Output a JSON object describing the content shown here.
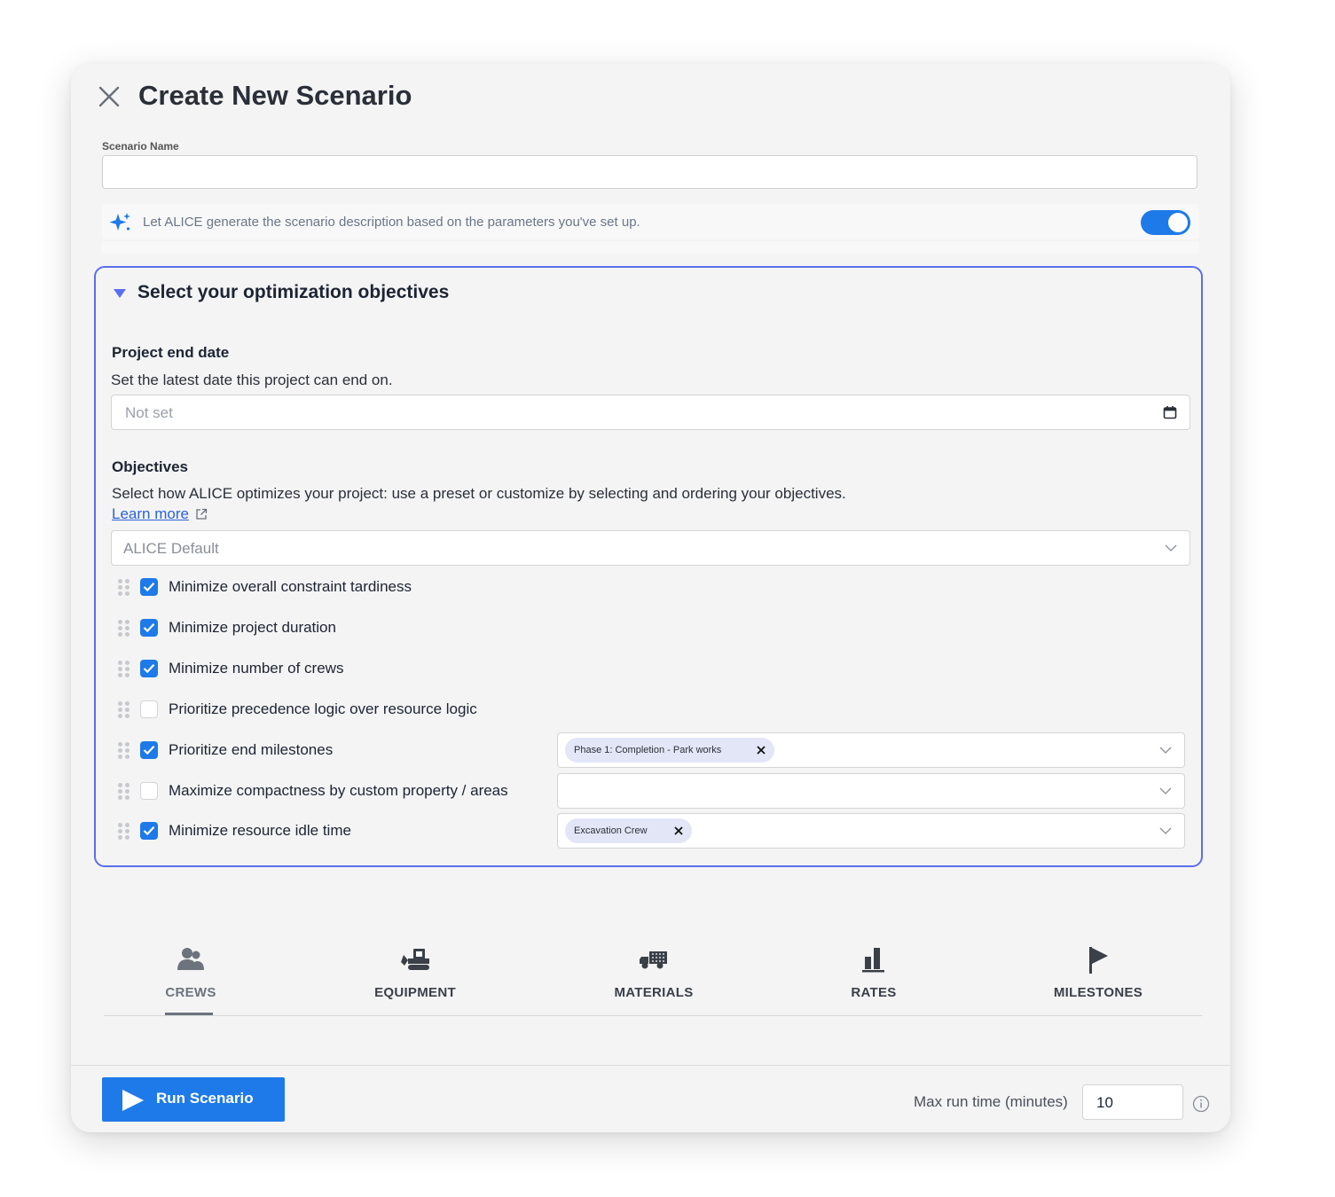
{
  "dialog": {
    "title": "Create New Scenario"
  },
  "scenario_name": {
    "label": "Scenario Name",
    "value": ""
  },
  "alice_generate": {
    "text": "Let ALICE generate the scenario description based on the parameters you've set up.",
    "enabled": true
  },
  "objectives_section": {
    "title": "Select your optimization objectives",
    "end_date": {
      "heading": "Project end date",
      "description": "Set the latest date this project can end on.",
      "placeholder": "Not set"
    },
    "objectives": {
      "heading": "Objectives",
      "description": "Select how ALICE optimizes your project: use a preset or customize by selecting and ordering your objectives.",
      "learn_more": "Learn more",
      "preset": "ALICE Default",
      "items": [
        {
          "label": "Minimize overall constraint tardiness",
          "checked": true
        },
        {
          "label": "Minimize project duration",
          "checked": true
        },
        {
          "label": "Minimize number of crews",
          "checked": true
        },
        {
          "label": "Prioritize precedence logic over resource logic",
          "checked": false
        },
        {
          "label": "Prioritize end milestones",
          "checked": true,
          "chip": "Phase 1: Completion - Park works"
        },
        {
          "label": "Maximize compactness by custom property / areas",
          "checked": false,
          "chip": ""
        },
        {
          "label": "Minimize resource idle time",
          "checked": true,
          "chip": "Excavation Crew"
        }
      ]
    }
  },
  "tabs": [
    {
      "label": "CREWS",
      "icon": "crew-icon",
      "active": true
    },
    {
      "label": "EQUIPMENT",
      "icon": "excavator-icon",
      "active": false
    },
    {
      "label": "MATERIALS",
      "icon": "truck-icon",
      "active": false
    },
    {
      "label": "RATES",
      "icon": "bar-chart-icon",
      "active": false
    },
    {
      "label": "MILESTONES",
      "icon": "flag-icon",
      "active": false
    }
  ],
  "footer": {
    "run_label": "Run Scenario",
    "max_run_label": "Max run time (minutes)",
    "max_run_value": "10"
  },
  "colors": {
    "accent": "#1e7ae8",
    "panel_border": "#5a6ef0",
    "chip": "#e3e6f7"
  }
}
